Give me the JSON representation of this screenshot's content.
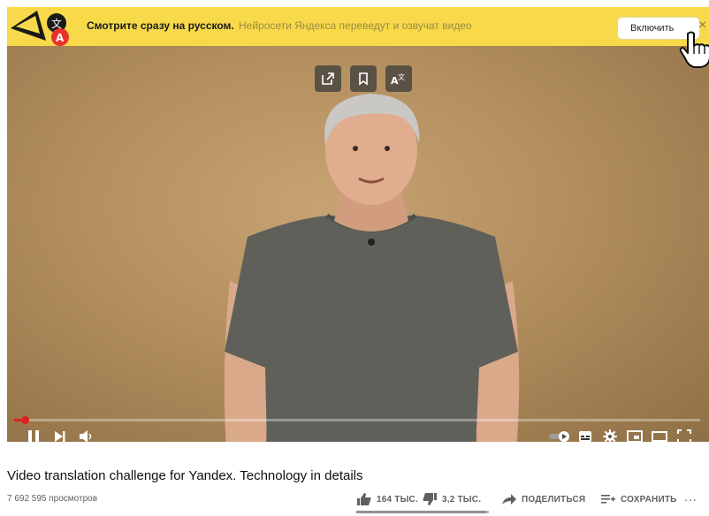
{
  "banner": {
    "title": "Смотрите сразу на русском.",
    "subtitle": "Нейросети Яндекса переведут и озвучат видео",
    "enable_label": "Включить",
    "close_label": "×",
    "logo_icon": "yandex-translate-logo-icon"
  },
  "overlay_buttons": [
    "open-external-icon",
    "bookmark-icon",
    "translate-icon"
  ],
  "player": {
    "progress": 0.016,
    "controls_left": [
      "pause-icon",
      "next-icon",
      "volume-icon"
    ],
    "controls_right": [
      "autoplay-toggle-icon",
      "subtitles-icon",
      "settings-icon",
      "miniplayer-icon",
      "theater-mode-icon",
      "fullscreen-icon"
    ]
  },
  "video": {
    "title": "Video translation challenge for Yandex. Technology in details",
    "views": "7 692 595 просмотров",
    "likes": "164 ТЫС.",
    "dislikes": "3,2 ТЫС.",
    "share_label": "ПОДЕЛИТЬСЯ",
    "save_label": "СОХРАНИТЬ",
    "more_label": "...",
    "like_ratio": 0.98
  },
  "colors": {
    "banner_yellow": "#f7d94a",
    "progress_red": "#e02020",
    "backdrop": "#b38f5f"
  }
}
